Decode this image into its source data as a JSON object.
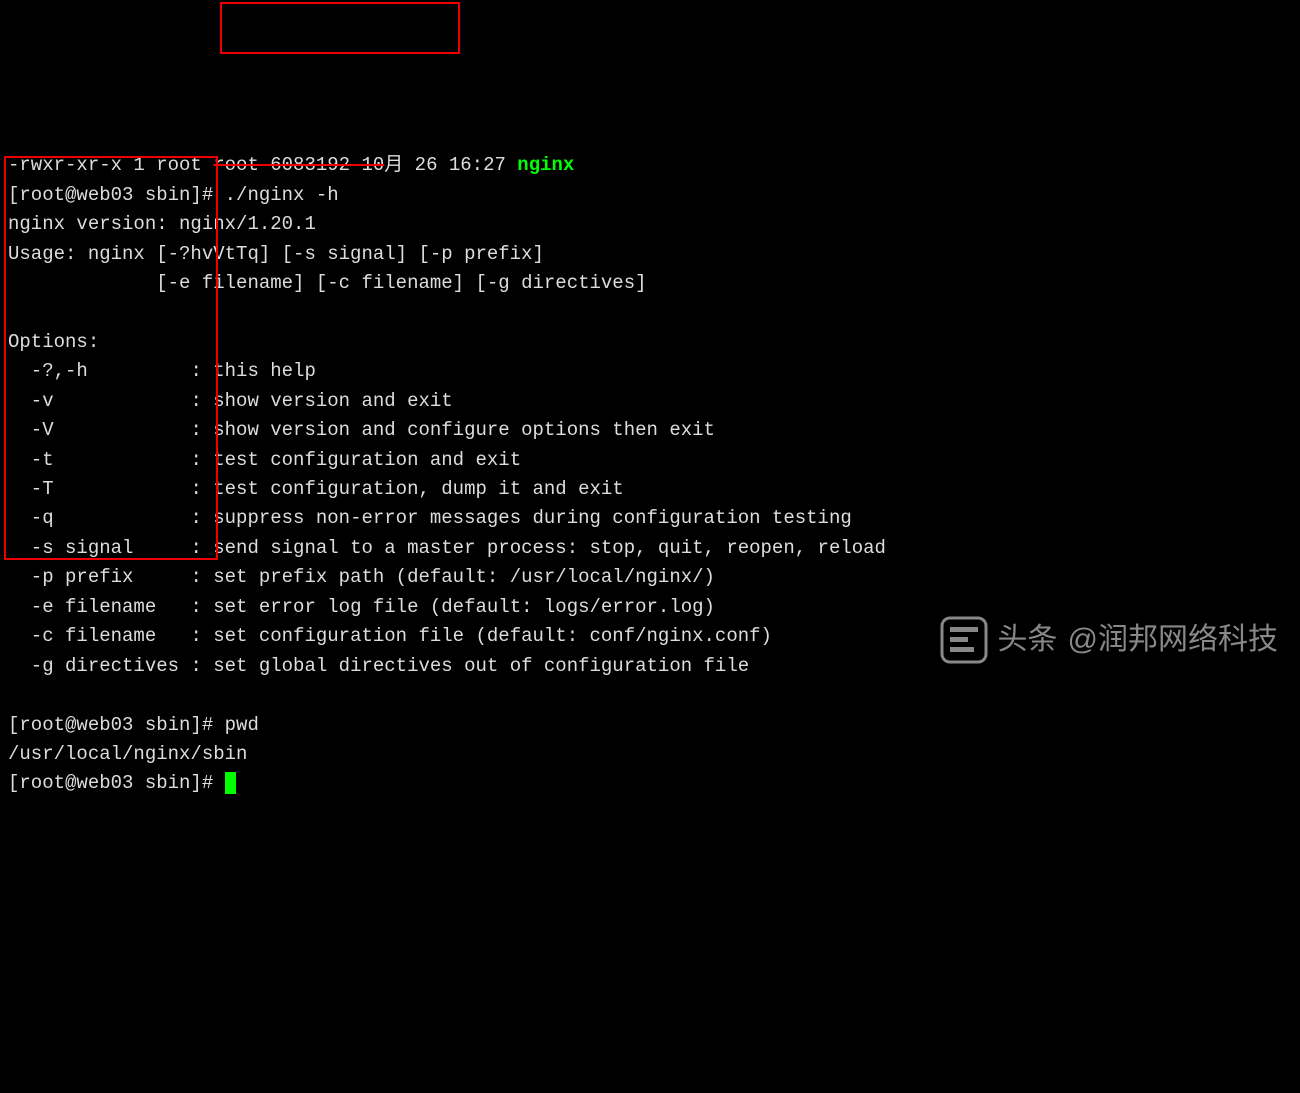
{
  "ls_line": {
    "perm": "-rwxr-xr-x 1 root ",
    "strike": "root 6083192 10",
    "mid": "月 26 16:27 ",
    "file": "nginx"
  },
  "prompt1": {
    "ps": "[root@web03 sbin]# ",
    "cmd": "./nginx -h"
  },
  "version_line": "nginx version: nginx/1.20.1",
  "usage1": "Usage: nginx [-?hvVtTq] [-s signal] [-p prefix]",
  "usage2": "             [-e filename] [-c filename] [-g directives]",
  "blank": "",
  "options_header": "Options:",
  "opts": [
    {
      "flag": "  -?,-h         ",
      "desc": ": this help"
    },
    {
      "flag": "  -v            ",
      "desc": ": show version and exit"
    },
    {
      "flag": "  -V            ",
      "desc": ": show version and configure options then exit"
    },
    {
      "flag": "  -t            ",
      "desc": ": test configuration and exit"
    },
    {
      "flag": "  -T            ",
      "desc": ": test configuration, dump it and exit"
    },
    {
      "flag": "  -q            ",
      "desc": ": suppress non-error messages during configuration testing"
    },
    {
      "flag": "  -s signal     ",
      "desc": ": send signal to a master process: stop, quit, reopen, reload"
    },
    {
      "flag": "  -p prefix     ",
      "desc": ": set prefix path (default: /usr/local/nginx/)"
    },
    {
      "flag": "  -e filename   ",
      "desc": ": set error log file (default: logs/error.log)"
    },
    {
      "flag": "  -c filename   ",
      "desc": ": set configuration file (default: conf/nginx.conf)"
    },
    {
      "flag": "  -g directives ",
      "desc": ": set global directives out of configuration file"
    }
  ],
  "prompt2": {
    "ps": "[root@web03 sbin]# ",
    "cmd": "pwd"
  },
  "pwd_out": "/usr/local/nginx/sbin",
  "prompt3": {
    "ps": "[root@web03 sbin]# "
  },
  "watermark": {
    "label": "头条",
    "author": "@润邦网络科技"
  }
}
